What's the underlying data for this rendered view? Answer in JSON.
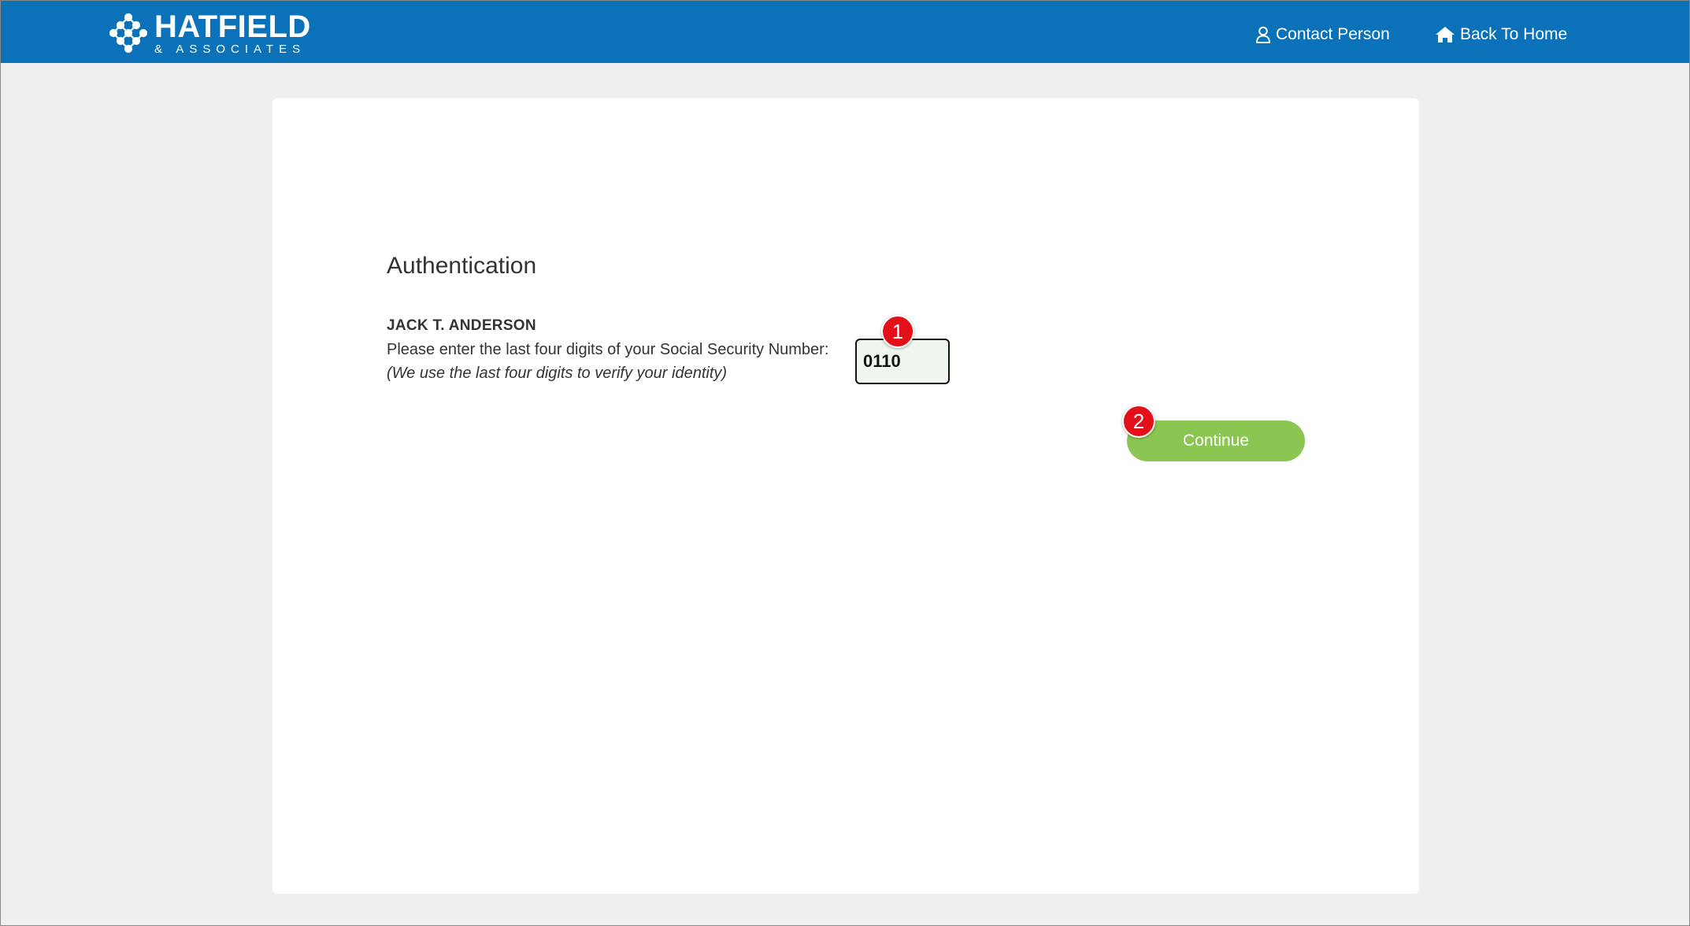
{
  "header": {
    "logo_name": "HATFIELD",
    "logo_sub": "& ASSOCIATES",
    "nav": {
      "contact_label": "Contact Person",
      "contact_icon": "user-icon",
      "home_label": "Back To Home",
      "home_icon": "home-icon"
    }
  },
  "auth": {
    "title": "Authentication",
    "person_name": "JACK T. ANDERSON",
    "ssn_prompt": "Please enter the last four digits of your Social Security Number:",
    "ssn_note": "(We use the last four digits to verify your identity)",
    "ssn_value": "0110",
    "continue_label": "Continue"
  },
  "annotations": {
    "badge_1": "1",
    "badge_2": "2"
  },
  "colors": {
    "header_bg": "#0b72ba",
    "page_bg": "#efefef",
    "continue_bg": "#8bc653",
    "badge_bg": "#e3101a",
    "input_bg": "#eef6ee"
  }
}
